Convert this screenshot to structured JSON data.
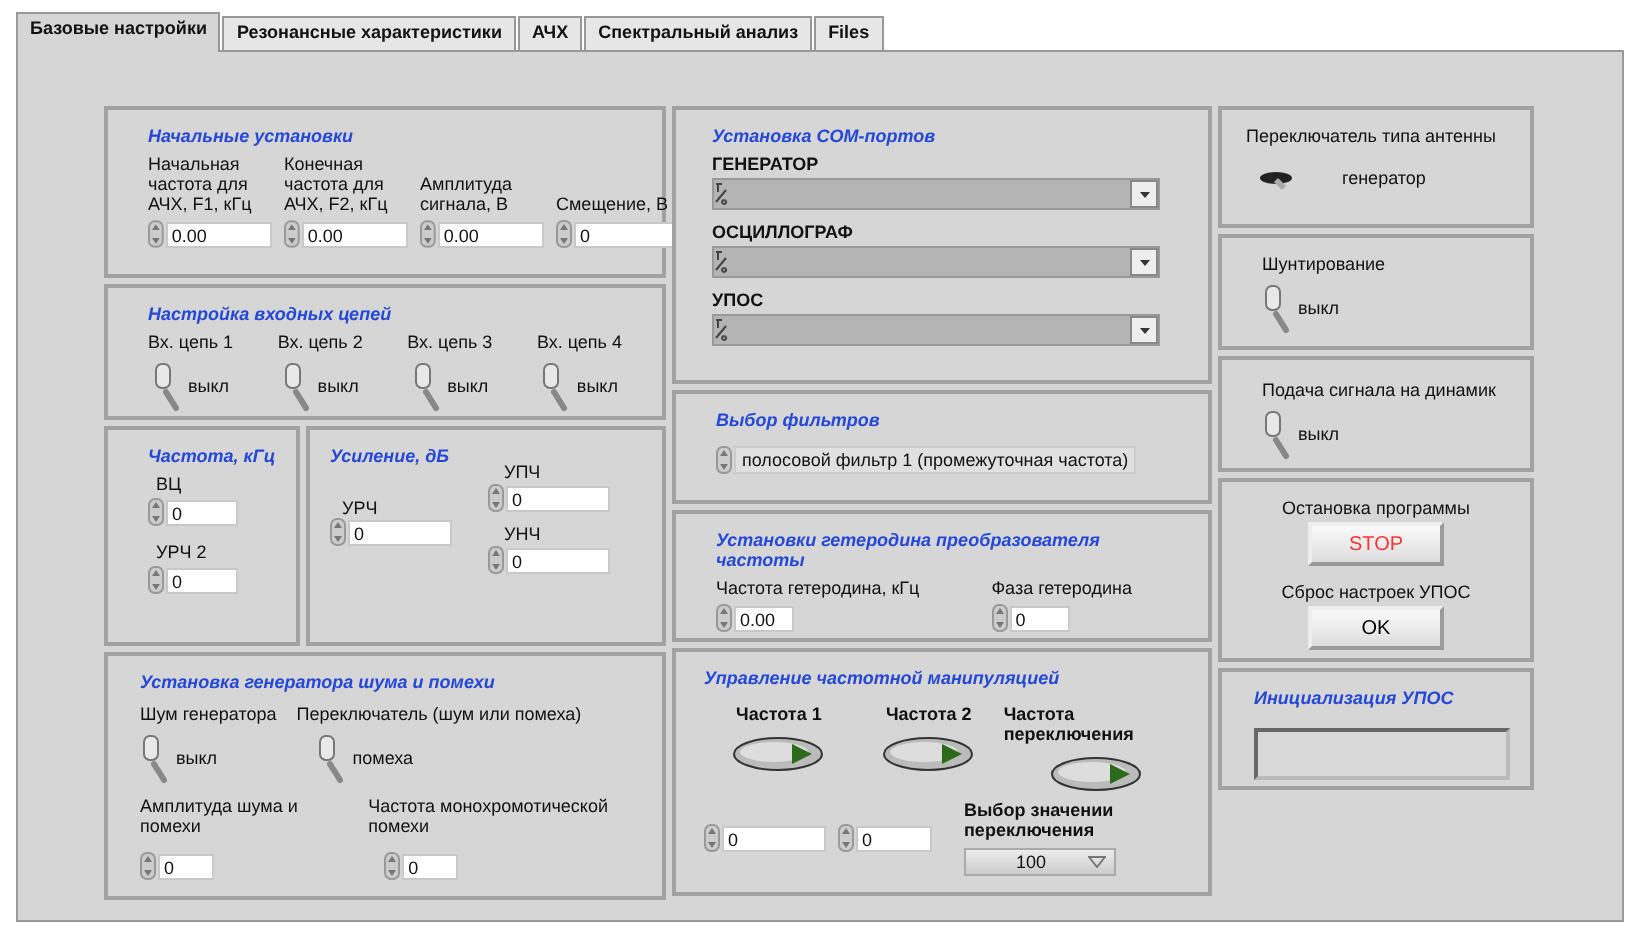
{
  "tabs": [
    {
      "label": "Базовые настройки",
      "selected": true
    },
    {
      "label": "Резонансные характеристики",
      "selected": false
    },
    {
      "label": "АЧХ",
      "selected": false
    },
    {
      "label": "Спектральный анализ",
      "selected": false
    },
    {
      "label": "Files",
      "selected": false
    }
  ],
  "start_settings": {
    "title": "Начальные установки",
    "fields": [
      {
        "label": "Начальная частота для АЧХ, F1, кГц",
        "value": "0.00"
      },
      {
        "label": "Конечная частота для АЧХ, F2, кГц",
        "value": "0.00"
      },
      {
        "label": "Амплитуда сигнала, В",
        "value": "0.00"
      },
      {
        "label": "Смещение, В",
        "value": "0"
      }
    ]
  },
  "input_circuits": {
    "title": "Настройка входных цепей",
    "switches": [
      {
        "label": "Вх. цепь 1",
        "state_text": "выкл",
        "on": false
      },
      {
        "label": "Вх. цепь 2",
        "state_text": "выкл",
        "on": false
      },
      {
        "label": "Вх. цепь 3",
        "state_text": "выкл",
        "on": false
      },
      {
        "label": "Вх. цепь 4",
        "state_text": "выкл",
        "on": false
      }
    ]
  },
  "frequency": {
    "title": "Частота, кГц",
    "fields": [
      {
        "label": "ВЦ",
        "value": "0"
      },
      {
        "label": "УРЧ 2",
        "value": "0"
      }
    ]
  },
  "gain": {
    "title": "Усиление, дБ",
    "fields": [
      {
        "label": "УРЧ",
        "value": "0"
      },
      {
        "label": "УПЧ",
        "value": "0"
      },
      {
        "label": "УНЧ",
        "value": "0"
      }
    ]
  },
  "noise": {
    "title": "Установка генератора шума и помехи",
    "switches": [
      {
        "label": "Шум генератора",
        "state_text": "выкл",
        "on": false
      },
      {
        "label": "Переключатель (шум или помеха)",
        "state_text": "помеха",
        "on": false
      }
    ],
    "fields": [
      {
        "label": "Амплитуда шума и помехи",
        "value": "0"
      },
      {
        "label": "Частота монохромотической помехи",
        "value": "0"
      }
    ]
  },
  "com_ports": {
    "title": "Установка COM-портов",
    "ports": [
      {
        "label": "ГЕНЕРАТОР"
      },
      {
        "label": "ОСЦИЛЛОГРАФ"
      },
      {
        "label": "УПОС"
      }
    ]
  },
  "filters": {
    "title": "Выбор фильтров",
    "value": "полосовой фильтр 1 (промежуточная частота)"
  },
  "heterodyne": {
    "title": "Установки гетеродина преобразователя частоты",
    "fields": [
      {
        "label": "Частота гетеродина, кГц",
        "value": "0.00"
      },
      {
        "label": "Фаза гетеродина",
        "value": "0"
      }
    ]
  },
  "fsk": {
    "title": "Управление частотной манипуляцией",
    "leds": [
      {
        "label": "Частота 1",
        "on": false
      },
      {
        "label": "Частота 2",
        "on": false
      },
      {
        "label": "Частота переключения",
        "on": false
      }
    ],
    "fields": [
      {
        "value": "0"
      },
      {
        "value": "0"
      }
    ],
    "switch_value": {
      "label": "Выбор значении переключения",
      "value": "100"
    }
  },
  "antenna": {
    "title": "Переключатель типа антенны",
    "state_text": "генератор",
    "on": false
  },
  "shunt": {
    "title": "Шунтирование",
    "state_text": "выкл",
    "on": false
  },
  "speaker": {
    "title": "Подача сигнала на динамик",
    "state_text": "выкл",
    "on": false
  },
  "stop": {
    "label": "Остановка программы",
    "button": "STOP"
  },
  "reset": {
    "label": "Сброс настроек УПОС",
    "button": "OK"
  },
  "init": {
    "title": "Инициализация УПОС"
  }
}
